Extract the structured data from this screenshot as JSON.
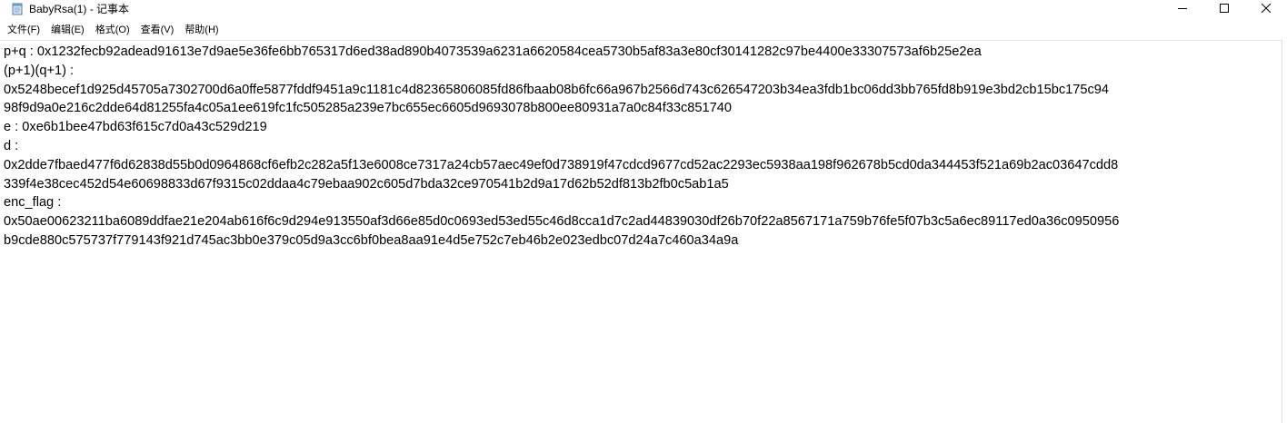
{
  "window": {
    "title": "BabyRsa(1) - 记事本",
    "icon": "notepad-icon",
    "controls": [
      "minimize-icon",
      "maximize-icon",
      "close-icon"
    ]
  },
  "menu": [
    {
      "label": "文件(F)"
    },
    {
      "label": "编辑(E)"
    },
    {
      "label": "格式(O)"
    },
    {
      "label": "查看(V)"
    },
    {
      "label": "帮助(H)"
    }
  ],
  "content": {
    "lines": [
      "p+q : 0x1232fecb92adead91613e7d9ae5e36fe6bb765317d6ed38ad890b4073539a6231a6620584cea5730b5af83a3e80cf30141282c97be4400e33307573af6b25e2ea",
      "(p+1)(q+1) :",
      "0x5248becef1d925d45705a7302700d6a0ffe5877fddf9451a9c1181c4d82365806085fd86fbaab08b6fc66a967b2566d743c626547203b34ea3fdb1bc06dd3bb765fd8b919e3bd2cb15bc175c94",
      "98f9d9a0e216c2dde64d81255fa4c05a1ee619fc1fc505285a239e7bc655ec6605d9693078b800ee80931a7a0c84f33c851740",
      "e : 0xe6b1bee47bd63f615c7d0a43c529d219",
      "d :",
      "0x2dde7fbaed477f6d62838d55b0d0964868cf6efb2c282a5f13e6008ce7317a24cb57aec49ef0d738919f47cdcd9677cd52ac2293ec5938aa198f962678b5cd0da344453f521a69b2ac03647cdd8",
      "339f4e38cec452d54e60698833d67f9315c02ddaa4c79ebaa902c605d7bda32ce970541b2d9a17d62b52df813b2fb0c5ab1a5",
      "enc_flag :",
      "0x50ae00623211ba6089ddfae21e204ab616f6c9d294e913550af3d66e85d0c0693ed53ed55c46d8cca1d7c2ad44839030df26b70f22a8567171a759b76fe5f07b3c5a6ec89117ed0a36c0950956",
      "b9cde880c575737f779143f921d745ac3bb0e379c05d9a3cc6bf0bea8aa91e4d5e752c7eb46b2e023edbc07d24a7c460a34a9a"
    ]
  }
}
